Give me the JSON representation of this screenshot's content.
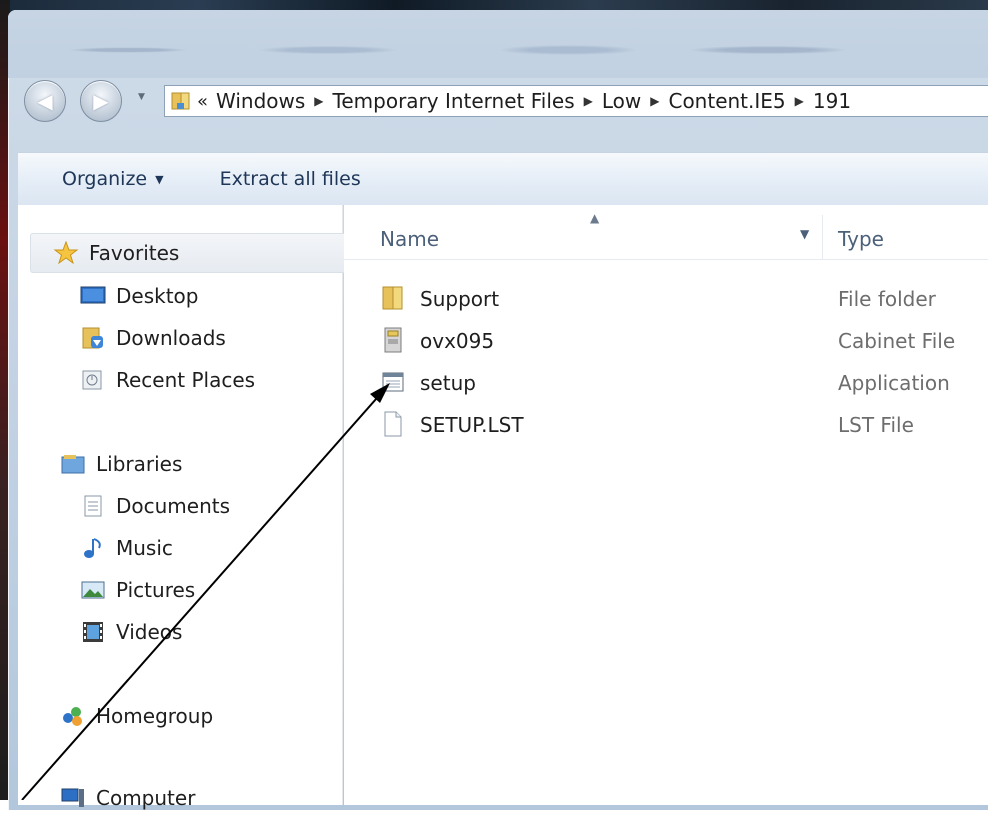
{
  "address_bar": {
    "overflow_label": "«",
    "crumbs": [
      "Windows",
      "Temporary Internet Files",
      "Low",
      "Content.IE5",
      "191"
    ]
  },
  "command_bar": {
    "organize_label": "Organize",
    "extract_label": "Extract all files"
  },
  "nav_pane": {
    "favorites": "Favorites",
    "desktop": "Desktop",
    "downloads": "Downloads",
    "recent_places": "Recent Places",
    "libraries": "Libraries",
    "documents": "Documents",
    "music": "Music",
    "pictures": "Pictures",
    "videos": "Videos",
    "homegroup": "Homegroup",
    "computer": "Computer"
  },
  "file_list": {
    "columns": {
      "name": "Name",
      "type": "Type"
    },
    "rows": [
      {
        "name": "Support",
        "type": "File folder",
        "icon": "folder-icon"
      },
      {
        "name": "ovx095",
        "type": "Cabinet File",
        "icon": "cabinet-file-icon"
      },
      {
        "name": "setup",
        "type": "Application",
        "icon": "application-icon"
      },
      {
        "name": "SETUP.LST",
        "type": "LST File",
        "icon": "document-icon"
      }
    ]
  },
  "colors": {
    "accent": "#1e3657",
    "chrome": "#c1d1e2",
    "muted_text": "#6d6d6d"
  }
}
